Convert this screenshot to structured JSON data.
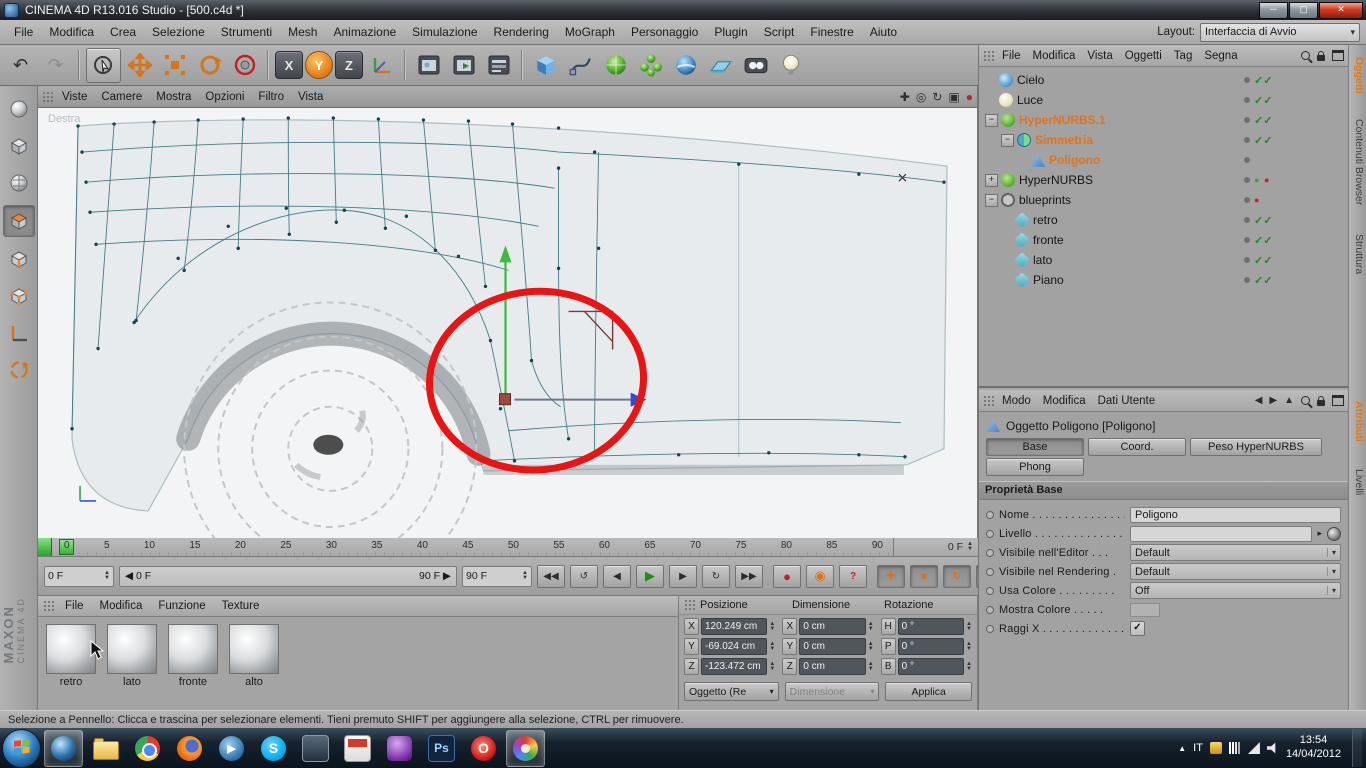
{
  "window": {
    "title": "CINEMA 4D R13.016 Studio - [500.c4d *]"
  },
  "menubar": {
    "items": [
      "File",
      "Modifica",
      "Crea",
      "Selezione",
      "Strumenti",
      "Mesh",
      "Animazione",
      "Simulazione",
      "Rendering",
      "MoGraph",
      "Personaggio",
      "Plugin",
      "Script",
      "Finestre",
      "Aiuto"
    ],
    "layout_label": "Layout:",
    "layout_value": "Interfaccia di Avvio"
  },
  "toolbar": {
    "axis_x": "X",
    "axis_y": "Y",
    "axis_z": "Z"
  },
  "viewport": {
    "menu": [
      "Viste",
      "Camere",
      "Mostra",
      "Opzioni",
      "Filtro",
      "Vista"
    ],
    "view_label": "Destra"
  },
  "timeline": {
    "ticks": [
      "0",
      "5",
      "10",
      "15",
      "20",
      "25",
      "30",
      "35",
      "40",
      "45",
      "50",
      "55",
      "60",
      "65",
      "70",
      "75",
      "80",
      "85",
      "90"
    ],
    "frame_box": "0 F",
    "current": "0 F",
    "range_start": "0 F",
    "range_end": "90 F",
    "end": "90 F"
  },
  "materials": {
    "menu": [
      "File",
      "Modifica",
      "Funzione",
      "Texture"
    ],
    "items": [
      {
        "name": "retro"
      },
      {
        "name": "lato"
      },
      {
        "name": "fronte"
      },
      {
        "name": "alto"
      }
    ]
  },
  "coords": {
    "columns": [
      {
        "header": "Posizione",
        "rows": [
          {
            "l": "X",
            "v": "120.249 cm"
          },
          {
            "l": "Y",
            "v": "-69.024 cm"
          },
          {
            "l": "Z",
            "v": "-123.472 cm"
          }
        ]
      },
      {
        "header": "Dimensione",
        "rows": [
          {
            "l": "X",
            "v": "0 cm"
          },
          {
            "l": "Y",
            "v": "0 cm"
          },
          {
            "l": "Z",
            "v": "0 cm"
          }
        ]
      },
      {
        "header": "Rotazione",
        "rows": [
          {
            "l": "H",
            "v": "0 °"
          },
          {
            "l": "P",
            "v": "0 °"
          },
          {
            "l": "B",
            "v": "0 °"
          }
        ]
      }
    ],
    "object_dropdown": "Oggetto (Re",
    "dimension_dropdown": "Dimensione",
    "apply": "Applica"
  },
  "object_manager": {
    "menu": [
      "File",
      "Modifica",
      "Vista",
      "Oggetti",
      "Tag",
      "Segna"
    ],
    "tree": [
      {
        "name": "Cielo",
        "icon": "sky",
        "depth": "0",
        "exp": "",
        "sel": "",
        "mark": "check",
        "tags": ""
      },
      {
        "name": "Luce",
        "icon": "light",
        "depth": "0",
        "exp": "",
        "sel": "",
        "mark": "check",
        "tags": ""
      },
      {
        "name": "HyperNURBS.1",
        "icon": "hn",
        "depth": "0",
        "exp": "minus",
        "sel": "1",
        "mark": "check",
        "tags": ""
      },
      {
        "name": "Simmetria",
        "icon": "sym",
        "depth": "1",
        "exp": "minus",
        "sel": "1",
        "mark": "check",
        "tags": ""
      },
      {
        "name": "Poligono",
        "icon": "poly",
        "depth": "2",
        "exp": "",
        "sel": "1",
        "mark": "",
        "tags": "poly"
      },
      {
        "name": "HyperNURBS",
        "icon": "hn",
        "depth": "0",
        "exp": "plus",
        "sel": "",
        "mark": "grdots",
        "tags": ""
      },
      {
        "name": "blueprints",
        "icon": "null",
        "depth": "0",
        "exp": "minus",
        "sel": "",
        "mark": "rdot",
        "tags": ""
      },
      {
        "name": "retro",
        "icon": "plane",
        "depth": "1",
        "exp": "",
        "sel": "",
        "mark": "check",
        "tags": "mat"
      },
      {
        "name": "fronte",
        "icon": "plane",
        "depth": "1",
        "exp": "",
        "sel": "",
        "mark": "check",
        "tags": "mat"
      },
      {
        "name": "lato",
        "icon": "plane",
        "depth": "1",
        "exp": "",
        "sel": "",
        "mark": "check",
        "tags": "mat"
      },
      {
        "name": "Piano",
        "icon": "plane",
        "depth": "1",
        "exp": "",
        "sel": "",
        "mark": "check",
        "tags": "mat"
      }
    ]
  },
  "attributes": {
    "menu": [
      "Modo",
      "Modifica",
      "Dati Utente"
    ],
    "title": "Oggetto Poligono [Poligono]",
    "tabs": {
      "base": "Base",
      "coord": "Coord.",
      "peso": "Peso HyperNURBS",
      "phong": "Phong"
    },
    "section": "Proprietà Base",
    "fields": {
      "nome": {
        "label": "Nome . . . . . . . . . . . . . . .",
        "value": "Poligono"
      },
      "livello": {
        "label": "Livello . . . . . . . . . . . . . ."
      },
      "vis_editor": {
        "label": "Visibile nell'Editor . . .",
        "value": "Default"
      },
      "vis_render": {
        "label": "Visibile nel Rendering .",
        "value": "Default"
      },
      "usa_colore": {
        "label": "Usa Colore . . . . . . . . .",
        "value": "Off"
      },
      "mostra_colore": {
        "label": "Mostra Colore . . . . ."
      },
      "raggi_x": {
        "label": "Raggi X . . . . . . . . . . . . .",
        "value": "✓"
      }
    }
  },
  "side_tabs": {
    "oggetti": "Oggetti",
    "contenuti": "Contenuti Browser",
    "struttura": "Struttura",
    "attributi": "Attributi",
    "livelli": "Livelli"
  },
  "statusbar": {
    "text": "Selezione a Pennello: Clicca e trascina per selezionare elementi. Tieni premuto SHIFT per aggiungere alla selezione, CTRL per rimuovere."
  },
  "taskbar": {
    "lang": "IT",
    "time": "13:54",
    "date": "14/04/2012"
  },
  "logo": {
    "line1": "MAXON",
    "line2": "CINEMA 4D"
  },
  "colors": {
    "accent_orange": "#e07818",
    "selection_red": "#e81515",
    "axis_green": "#3dbb3d",
    "axis_blue": "#3c46c8"
  }
}
